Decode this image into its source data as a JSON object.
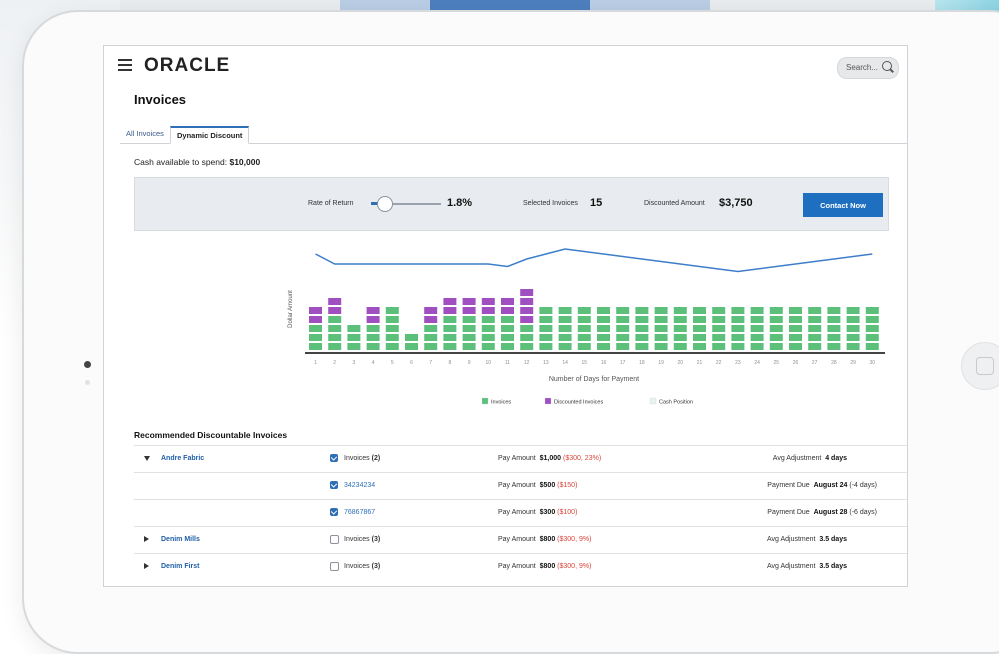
{
  "app": {
    "logo": "ORACLE",
    "search_placeholder": "Search...",
    "page_title": "Invoices"
  },
  "tabs": [
    {
      "label": "All Invoices",
      "active": false
    },
    {
      "label": "Dynamic Discount",
      "active": true
    }
  ],
  "cash": {
    "label": "Cash available to spend:",
    "value": "$10,000"
  },
  "controls": {
    "rate_label": "Rate of Return",
    "rate_value": "1.8%",
    "rate_fraction": 0.18,
    "selected_label": "Selected Invoices",
    "selected_value": "15",
    "discounted_label": "Discounted Amount",
    "discounted_value": "$3,750",
    "contact_label": "Contact Now"
  },
  "chart_data": {
    "type": "bar",
    "ylabel": "Dollar Amount",
    "xlabel": "Number of Days for Payment",
    "x_ticks": [
      "1",
      "2",
      "3",
      "4",
      "5",
      "6",
      "7",
      "8",
      "9",
      "10",
      "11",
      "12",
      "13",
      "14",
      "15",
      "16",
      "17",
      "18",
      "19",
      "20",
      "21",
      "22",
      "23",
      "24",
      "25",
      "26",
      "27",
      "28",
      "29",
      "30"
    ],
    "series": [
      {
        "name": "Invoices",
        "color": "#5cc07a",
        "values": [
          3,
          4,
          3,
          3,
          5,
          2,
          3,
          4,
          4,
          4,
          4,
          3,
          5,
          5,
          5,
          5,
          5,
          5,
          5,
          5,
          5,
          5,
          5,
          5,
          5,
          5,
          5,
          5,
          5,
          5
        ]
      },
      {
        "name": "Discounted Invoices",
        "color": "#a04fc0",
        "values": [
          2,
          2,
          0,
          2,
          0,
          0,
          2,
          2,
          2,
          2,
          2,
          4,
          0,
          0,
          0,
          0,
          0,
          0,
          0,
          0,
          0,
          0,
          0,
          0,
          0,
          0,
          0,
          0,
          0,
          0
        ]
      },
      {
        "name": "Cash Position",
        "color": "#3d7ec9",
        "type": "line",
        "values": [
          9,
          7,
          7,
          7,
          7,
          7,
          7,
          7,
          7,
          7,
          6.5,
          8,
          9,
          10,
          9.5,
          9,
          8.5,
          8,
          7.5,
          7,
          6.5,
          6,
          5.5,
          6,
          6.5,
          7,
          7.5,
          8,
          8.5,
          9
        ]
      }
    ],
    "legend": [
      "Invoices",
      "Discounted Invoices",
      "Cash Position"
    ],
    "legend_colors": [
      "#5cc07a",
      "#a04fc0",
      "#e8f3ea"
    ],
    "legend_placement": "bottom"
  },
  "section_title": "Recommended Discountable Invoices",
  "rows": [
    {
      "type": "group",
      "expanded": true,
      "name": "Andre Fabric",
      "checked": true,
      "inv_label": "Invoices",
      "inv_count": "(2)",
      "pay_label": "Pay Amount",
      "pay_amount": "$1,000",
      "pay_detail": "($300, 23%)",
      "adj_label": "Avg Adjustment",
      "adj_value": "4 days"
    },
    {
      "type": "child",
      "checked": true,
      "inv_label": "34234234",
      "pay_label": "Pay Amount",
      "pay_amount": "$500",
      "pay_detail": "($150)",
      "due_label": "Payment Due",
      "due_value": "August 24",
      "due_detail": "(-4 days)"
    },
    {
      "type": "child",
      "checked": true,
      "inv_label": "76867867",
      "pay_label": "Pay Amount",
      "pay_amount": "$300",
      "pay_detail": "($100)",
      "due_label": "Payment Due",
      "due_value": "August 28",
      "due_detail": "(-6 days)"
    },
    {
      "type": "group",
      "expanded": false,
      "name": "Denim Mills",
      "checked": false,
      "inv_label": "Invoices",
      "inv_count": "(3)",
      "pay_label": "Pay Amount",
      "pay_amount": "$800",
      "pay_detail": "($300, 9%)",
      "adj_label": "Avg Adjustment",
      "adj_value": "3.5 days"
    },
    {
      "type": "group",
      "expanded": false,
      "name": "Denim First",
      "checked": false,
      "inv_label": "Invoices",
      "inv_count": "(3)",
      "pay_label": "Pay Amount",
      "pay_amount": "$800",
      "pay_detail": "($300, 9%)",
      "adj_label": "Avg Adjustment",
      "adj_value": "3.5 days"
    }
  ]
}
